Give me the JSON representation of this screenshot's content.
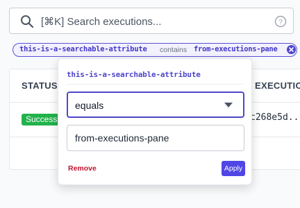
{
  "search": {
    "shortcut": "[⌘K]",
    "placeholder": "Search executions..."
  },
  "filter_chip": {
    "attribute": "this-is-a-searchable-attribute",
    "operator": "contains",
    "value": "from-executions-pane"
  },
  "table": {
    "columns": [
      "STATUS",
      "EXECUTION I"
    ],
    "rows": [
      {
        "status": "Success",
        "execution_id": "c268e5d.."
      }
    ]
  },
  "popover": {
    "title": "this-is-a-searchable-attribute",
    "operator_selected": "equals",
    "value": "from-executions-pane",
    "remove_label": "Remove",
    "apply_label": "Apply"
  },
  "colors": {
    "accent": "#4f46e5",
    "success": "#22b24c",
    "danger": "#c0142e"
  },
  "icons": [
    "search-icon",
    "help-icon",
    "close-icon",
    "chevron-down-icon"
  ]
}
